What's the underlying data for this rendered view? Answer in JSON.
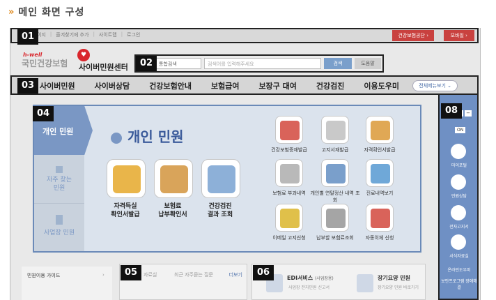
{
  "page_heading": {
    "chevron": "»",
    "title": "메인 화면 구성"
  },
  "badges": {
    "b01": "01",
    "b02": "02",
    "b03": "03",
    "b04": "04",
    "b05": "05",
    "b06": "06",
    "b08": "08"
  },
  "topbar": {
    "links": [
      "이지",
      "즐겨찾기에 추가",
      "사이트맵",
      "로그인"
    ],
    "btn_nhis": "건강보험공단 ›",
    "btn_mobile": "모바일 ›"
  },
  "logo": {
    "hwell": "h-well",
    "org": "국민건강보험",
    "cyber": "사이버민원센터"
  },
  "search": {
    "scope": "통합검색",
    "placeholder": "검색어를 입력해주세요",
    "go": "검색",
    "help": "도움말"
  },
  "nav": {
    "items": [
      "사이버민원",
      "사이버상담",
      "건강보험안내",
      "보험급여",
      "보장구 대여",
      "건강검진",
      "이용도우미"
    ],
    "all_menu": "전체메뉴보기 ⌄"
  },
  "main": {
    "tab_active": "개인 민원",
    "tab_find": [
      "자주 찾는",
      "민원"
    ],
    "tab_biz": "사업장 민원",
    "title": "개인 민원",
    "big_items": [
      {
        "label1": "자격득실",
        "label2": "확인서발급",
        "color": "#e9b54a"
      },
      {
        "label1": "보험료",
        "label2": "납부확인서",
        "color": "#d9a45a"
      },
      {
        "label1": "건강검진",
        "label2": "결과 조회",
        "color": "#8db0d8"
      }
    ],
    "small_items": [
      {
        "label": "건강보험증재발급",
        "color": "#d9635a"
      },
      {
        "label": "고지서재발급",
        "color": "#c9c9c9"
      },
      {
        "label": "자격확인서발급",
        "color": "#e0a855"
      },
      {
        "label": "보험료 부과내역",
        "color": "#b9b9b9"
      },
      {
        "label": "개인별 연말정산 내역 조회",
        "color": "#7a9fcb"
      },
      {
        "label": "진료내역보기",
        "color": "#6fa8d8"
      },
      {
        "label": "이메일 고지신청",
        "color": "#e0c04a"
      },
      {
        "label": "납부할 보험료조회",
        "color": "#a5a5a5"
      },
      {
        "label": "자동이체 신청",
        "color": "#d9635a"
      }
    ]
  },
  "right_panel": {
    "zoom_label": "화면",
    "on": "ON",
    "items": [
      "마이포털",
      "민원상담",
      "전자고지서",
      "서식자료실",
      "온라인도우미",
      "보안프로그램 장애해결"
    ]
  },
  "bottom": {
    "guide": "민원이용 가이드",
    "panel05_tab1": "자료실",
    "panel05_tab2": "최근 자주묻는 질문",
    "panel05_more": "더보기",
    "edi_title": "EDI서비스",
    "edi_tag": "(사업장용)",
    "edi_sub": "사업장 전자민원 신고서",
    "ltc_title": "장기요양 민원",
    "ltc_sub": "장기요양 민원 바로가기"
  }
}
